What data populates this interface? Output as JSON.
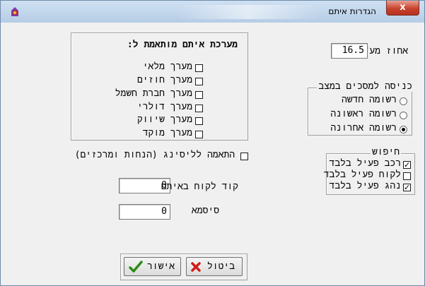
{
  "window": {
    "title": "הגדרות איתם",
    "close_symbol": "x"
  },
  "percent": {
    "label": "אחוז מע\"מ",
    "value": "16.5"
  },
  "system_group": {
    "title": "מערכת איתם מותאמת ל:",
    "items": [
      {
        "label": "מערך מלאי",
        "checked": false
      },
      {
        "label": "מערך חוזים",
        "checked": false
      },
      {
        "label": "מערך חברת חשמל",
        "checked": false
      },
      {
        "label": "מערך דולרי",
        "checked": false
      },
      {
        "label": "מערך שיווק",
        "checked": false
      },
      {
        "label": "מערך מוקד",
        "checked": false
      }
    ]
  },
  "entry_group": {
    "title": "כניסה למסכים במצב",
    "options": [
      {
        "label": "רשומה חדשה",
        "selected": false
      },
      {
        "label": "רשומה ראשונה",
        "selected": false
      },
      {
        "label": "רשומה אחרונה",
        "selected": true
      }
    ]
  },
  "search_group": {
    "title": "חיפוש",
    "items": [
      {
        "label": "רכב פעיל בלבד",
        "checked": true
      },
      {
        "label": "לקוח פעיל בלבד",
        "checked": false
      },
      {
        "label": "נהג פעיל בלבד",
        "checked": true
      }
    ]
  },
  "leasing": {
    "label": "התאמה לליסינג (הנחות ומרכזים)",
    "checked": false
  },
  "client_code": {
    "label": "קוד לקוח באיתם",
    "value": "0"
  },
  "password": {
    "label": "סיסמא",
    "value": "0"
  },
  "buttons": {
    "ok": "אישור",
    "cancel": "ביטול"
  }
}
